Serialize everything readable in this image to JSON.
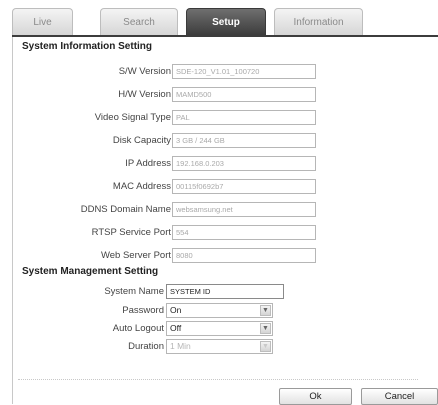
{
  "tabs": [
    {
      "label": "Live",
      "active": false
    },
    {
      "label": "Search",
      "active": false
    },
    {
      "label": "Setup",
      "active": true
    },
    {
      "label": "Information",
      "active": false
    }
  ],
  "system_info": {
    "title": "System Information Setting",
    "rows": [
      {
        "label": "S/W Version",
        "value": "SDE-120_V1.01_100720"
      },
      {
        "label": "H/W Version",
        "value": "MAMD500"
      },
      {
        "label": "Video Signal Type",
        "value": "PAL"
      },
      {
        "label": "Disk Capacity",
        "value": "3 GB / 244 GB"
      },
      {
        "label": "IP Address",
        "value": "192.168.0.203"
      },
      {
        "label": "MAC Address",
        "value": "00115f0692b7"
      },
      {
        "label": "DDNS Domain Name",
        "value": "websamsung.net"
      },
      {
        "label": "RTSP Service Port",
        "value": "554"
      },
      {
        "label": "Web Server Port",
        "value": "8080"
      }
    ]
  },
  "system_mgmt": {
    "title": "System Management Setting",
    "system_name": {
      "label": "System Name",
      "value": "SYSTEM ID"
    },
    "password": {
      "label": "Password",
      "value": "On"
    },
    "auto_logout": {
      "label": "Auto Logout",
      "value": "Off"
    },
    "duration": {
      "label": "Duration",
      "value": "1 Min"
    }
  },
  "buttons": {
    "ok": "Ok",
    "cancel": "Cancel"
  },
  "icons": {
    "dropdown": "chevron-down-icon"
  },
  "colors": {
    "active_tab": "#4a4a4a",
    "tab_inactive": "#e3e3e3",
    "border": "#b6b6b6"
  }
}
